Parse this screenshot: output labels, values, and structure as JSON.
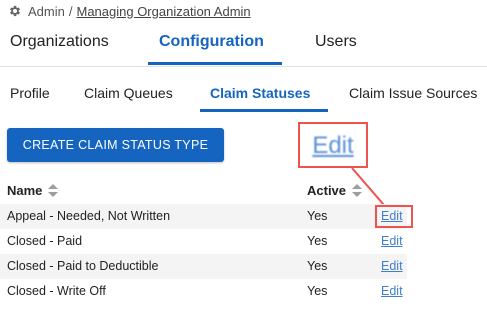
{
  "breadcrumb": {
    "root": "Admin",
    "separator": "/",
    "current": "Managing Organization Admin",
    "icon": "gear-icon"
  },
  "main_tabs": [
    {
      "label": "Organizations",
      "active": false
    },
    {
      "label": "Configuration",
      "active": true
    },
    {
      "label": "Users",
      "active": false
    }
  ],
  "sub_tabs": [
    {
      "label": "Profile",
      "active": false
    },
    {
      "label": "Claim Queues",
      "active": false
    },
    {
      "label": "Claim Statuses",
      "active": true
    },
    {
      "label": "Claim Issue Sources",
      "active": false
    }
  ],
  "toolbar": {
    "create_label": "CREATE CLAIM STATUS TYPE"
  },
  "callout": {
    "zoom_label": "Edit",
    "highlight_color": "#ef5350"
  },
  "table": {
    "columns": [
      {
        "label": "Name",
        "sortable": true
      },
      {
        "label": "Active",
        "sortable": true
      }
    ],
    "rows": [
      {
        "name": "Appeal - Needed, Not Written",
        "active": "Yes",
        "action": "Edit"
      },
      {
        "name": "Closed - Paid",
        "active": "Yes",
        "action": "Edit"
      },
      {
        "name": "Closed - Paid to Deductible",
        "active": "Yes",
        "action": "Edit"
      },
      {
        "name": "Closed - Write Off",
        "active": "Yes",
        "action": "Edit"
      }
    ]
  },
  "colors": {
    "accent": "#1565c0",
    "link": "#3f7fd0",
    "row_stripe": "#f4f4f4"
  }
}
